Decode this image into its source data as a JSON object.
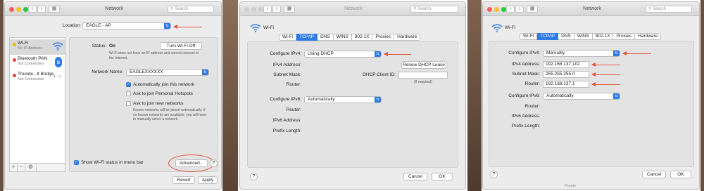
{
  "colors": {
    "accent": "#2f7ae5",
    "annotation": "#e2563f",
    "green": "#27c93f",
    "red": "#ff5f57",
    "yellow": "#ffbd2e"
  },
  "panel1": {
    "title": "Network",
    "search_placeholder": "Search",
    "location_label": "Location:",
    "location_value": "EAGLE - AP",
    "sidebar": [
      {
        "name": "Wi-Fi",
        "status": "No IP Address",
        "icon": "wifi-icon"
      },
      {
        "name": "Bluetooth PAN",
        "status": "Not Connected",
        "icon": "bluetooth-icon"
      },
      {
        "name": "Thunde...lt Bridge",
        "status": "Not Connected",
        "icon": "thunderbolt-bridge-icon"
      }
    ],
    "status_label": "Status:",
    "status_value": "On",
    "turn_off_button": "Turn Wi-Fi Off",
    "status_note": "Wi-Fi does not have an IP address and cannot connect to the Internet.",
    "network_name_label": "Network Name:",
    "network_name_value": "EAGLEXXXXXX",
    "auto_join": "Automatically join this network",
    "ask_hotspots": "Ask to join Personal Hotspots",
    "ask_new": "Ask to join new networks",
    "ask_new_note": "Known networks will be joined automatically. If no known networks are available, you will have to manually select a network.",
    "show_status": "Show Wi-Fi status in menu bar",
    "advanced_button": "Advanced...",
    "help": "?",
    "revert_button": "Revert",
    "apply_button": "Apply"
  },
  "panel2": {
    "title": "Network",
    "search_placeholder": "Search",
    "wifi_label": "Wi-Fi",
    "tabs": [
      "Wi-Fi",
      "TCP/IP",
      "DNS",
      "WINS",
      "802.1X",
      "Proxies",
      "Hardware"
    ],
    "active_tab": "TCP/IP",
    "configure_ipv4_label": "Configure IPv4:",
    "configure_ipv4_value": "Using DHCP",
    "ipv4_address_label": "IPv4 Address:",
    "renew_button": "Renew DHCP Lease",
    "subnet_label": "Subnet Mask:",
    "dhcp_client_label": "DHCP Client ID:",
    "if_required": "(If required)",
    "router_label": "Router:",
    "configure_ipv6_label": "Configure IPv6:",
    "configure_ipv6_value": "Automatically",
    "router6_label": "Router:",
    "ipv6_address_label": "IPv6 Address:",
    "prefix_label": "Prefix Length:",
    "help": "?",
    "cancel_button": "Cancel",
    "ok_button": "OK"
  },
  "panel3": {
    "title": "Network",
    "search_placeholder": "Search",
    "wifi_label": "Wi-Fi",
    "tabs": [
      "Wi-Fi",
      "TCP/IP",
      "DNS",
      "WINS",
      "802.1X",
      "Proxies",
      "Hardware"
    ],
    "active_tab": "TCP/IP",
    "configure_ipv4_label": "Configure IPv4:",
    "configure_ipv4_value": "Manually",
    "ipv4_address_label": "IPv4 Address:",
    "ipv4_address_value": "192.168.137.102",
    "subnet_label": "Subnet Mask:",
    "subnet_value": "255.255.255.0",
    "router_label": "Router:",
    "router_value": "192.168.137.1",
    "configure_ipv6_label": "Configure IPv6:",
    "configure_ipv6_value": "Automatically",
    "router6_label": "Router:",
    "ipv6_address_label": "IPv6 Address:",
    "prefix_label": "Prefix Length:",
    "help": "?",
    "cancel_button": "Cancel",
    "ok_button": "OK",
    "footer_text": "Purple"
  }
}
